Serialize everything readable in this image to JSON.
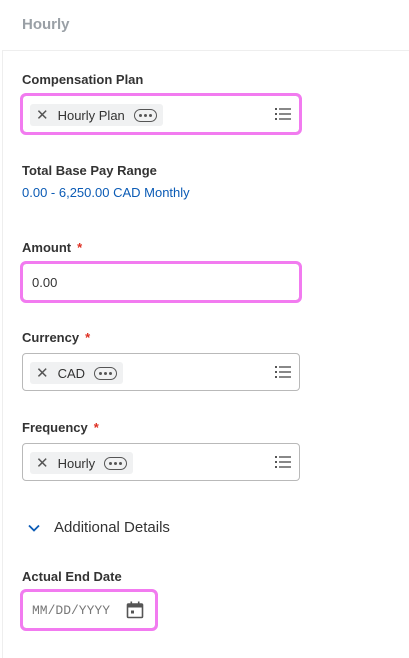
{
  "header": {
    "title": "Hourly"
  },
  "compensation_plan": {
    "label": "Compensation Plan",
    "value": "Hourly Plan"
  },
  "base_pay_range": {
    "label": "Total Base Pay Range",
    "value": "0.00 - 6,250.00 CAD Monthly"
  },
  "amount": {
    "label": "Amount",
    "required_marker": "*",
    "value": "0.00"
  },
  "currency": {
    "label": "Currency",
    "required_marker": "*",
    "value": "CAD"
  },
  "frequency": {
    "label": "Frequency",
    "required_marker": "*",
    "value": "Hourly"
  },
  "additional_details": {
    "label": "Additional Details"
  },
  "actual_end_date": {
    "label": "Actual End Date",
    "placeholder": "MM/DD/YYYY"
  },
  "colors": {
    "link": "#0b5bb5",
    "required": "#de2e21",
    "highlight": "#f27bf0",
    "header_text": "#9aa0a6"
  },
  "icons": {
    "remove": "close-icon",
    "more": "ellipsis-icon",
    "prompt": "list-icon",
    "expand": "chevron-down-icon",
    "calendar": "calendar-icon"
  }
}
